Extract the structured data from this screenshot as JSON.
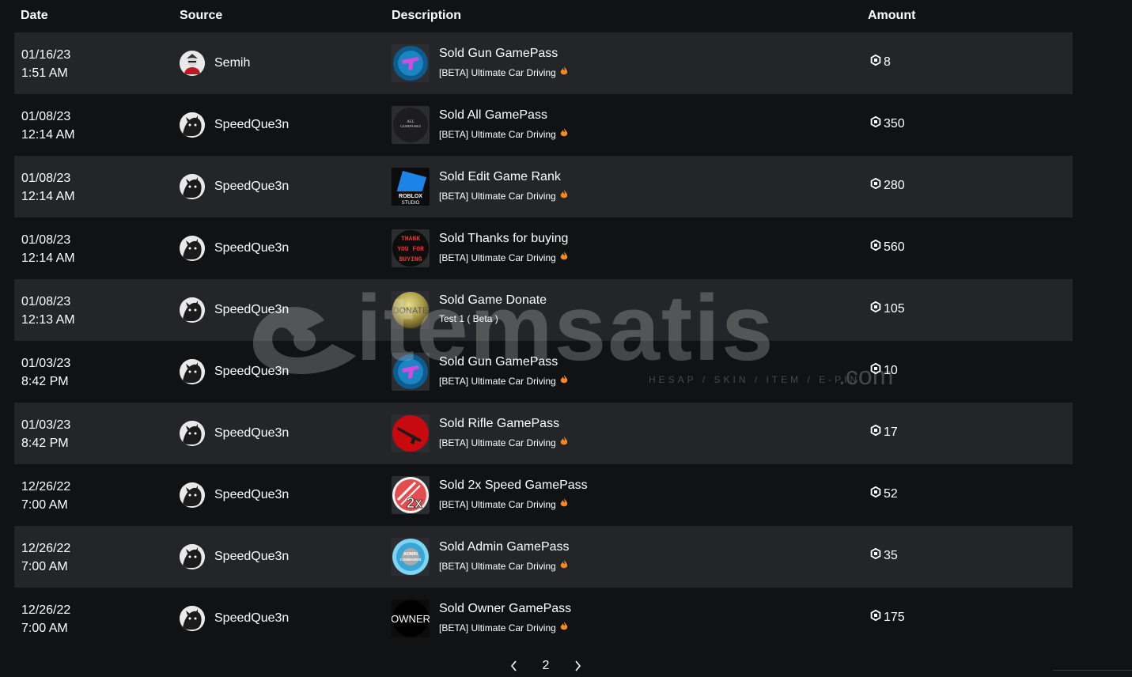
{
  "header": {
    "date": "Date",
    "source": "Source",
    "description": "Description",
    "amount": "Amount"
  },
  "rows": [
    {
      "date": "01/16/23",
      "time": "1:51 AM",
      "source": "Semih",
      "avatar": "semih-avatar-icon",
      "title": "Sold Gun GamePass",
      "sub": "[BETA] Ultimate Car Driving",
      "thumb": "gun-gamepass",
      "amount": "8"
    },
    {
      "date": "01/08/23",
      "time": "12:14 AM",
      "source": "SpeedQue3n",
      "avatar": "speedque3n-avatar-icon",
      "title": "Sold All GamePass",
      "sub": "[BETA] Ultimate Car Driving",
      "thumb": "all-gamepass",
      "thumb_text": "ALL GAMEPASSES",
      "amount": "350"
    },
    {
      "date": "01/08/23",
      "time": "12:14 AM",
      "source": "SpeedQue3n",
      "avatar": "speedque3n-avatar-icon",
      "title": "Sold Edit Game Rank",
      "sub": "[BETA] Ultimate Car Driving",
      "thumb": "roblox-studio",
      "thumb_text": "ROBLOX STUDIO",
      "amount": "280"
    },
    {
      "date": "01/08/23",
      "time": "12:14 AM",
      "source": "SpeedQue3n",
      "avatar": "speedque3n-avatar-icon",
      "title": "Sold Thanks for buying",
      "sub": "[BETA] Ultimate Car Driving",
      "thumb": "thank-you",
      "thumb_text": "THANK YOU FOR BUYING",
      "amount": "560"
    },
    {
      "date": "01/08/23",
      "time": "12:13 AM",
      "source": "SpeedQue3n",
      "avatar": "speedque3n-avatar-icon",
      "title": "Sold Game Donate",
      "sub": "Test 1 ( Beta )",
      "flame": false,
      "thumb": "donate",
      "thumb_text": "DONATE",
      "amount": "105"
    },
    {
      "date": "01/03/23",
      "time": "8:42 PM",
      "source": "SpeedQue3n",
      "avatar": "speedque3n-avatar-icon",
      "title": "Sold Gun GamePass",
      "sub": "[BETA] Ultimate Car Driving",
      "thumb": "gun-gamepass",
      "amount": "10"
    },
    {
      "date": "01/03/23",
      "time": "8:42 PM",
      "source": "SpeedQue3n",
      "avatar": "speedque3n-avatar-icon",
      "title": "Sold Rifle GamePass",
      "sub": "[BETA] Ultimate Car Driving",
      "thumb": "rifle-gamepass",
      "amount": "17"
    },
    {
      "date": "12/26/22",
      "time": "7:00 AM",
      "source": "SpeedQue3n",
      "avatar": "speedque3n-avatar-icon",
      "title": "Sold 2x Speed GamePass",
      "sub": "[BETA] Ultimate Car Driving",
      "thumb": "speed-2x",
      "thumb_text": "2x",
      "amount": "52"
    },
    {
      "date": "12/26/22",
      "time": "7:00 AM",
      "source": "SpeedQue3n",
      "avatar": "speedque3n-avatar-icon",
      "title": "Sold Admin GamePass",
      "sub": "[BETA] Ultimate Car Driving",
      "thumb": "admin-commands",
      "thumb_text": "ADMIN COMMANDS",
      "amount": "35"
    },
    {
      "date": "12/26/22",
      "time": "7:00 AM",
      "source": "SpeedQue3n",
      "avatar": "speedque3n-avatar-icon",
      "title": "Sold Owner GamePass",
      "sub": "[BETA] Ultimate Car Driving",
      "thumb": "owner",
      "thumb_text": "OWNER",
      "amount": "175"
    }
  ],
  "pager": {
    "page": "2"
  },
  "watermark": {
    "brand": "itemsatis",
    "tagline": "HESAP / SKIN / ITEM / E-PIN",
    "suffix": ".com"
  },
  "colors": {
    "row_alt": "#232528",
    "background": "#111214",
    "flame": "#f5891f"
  }
}
